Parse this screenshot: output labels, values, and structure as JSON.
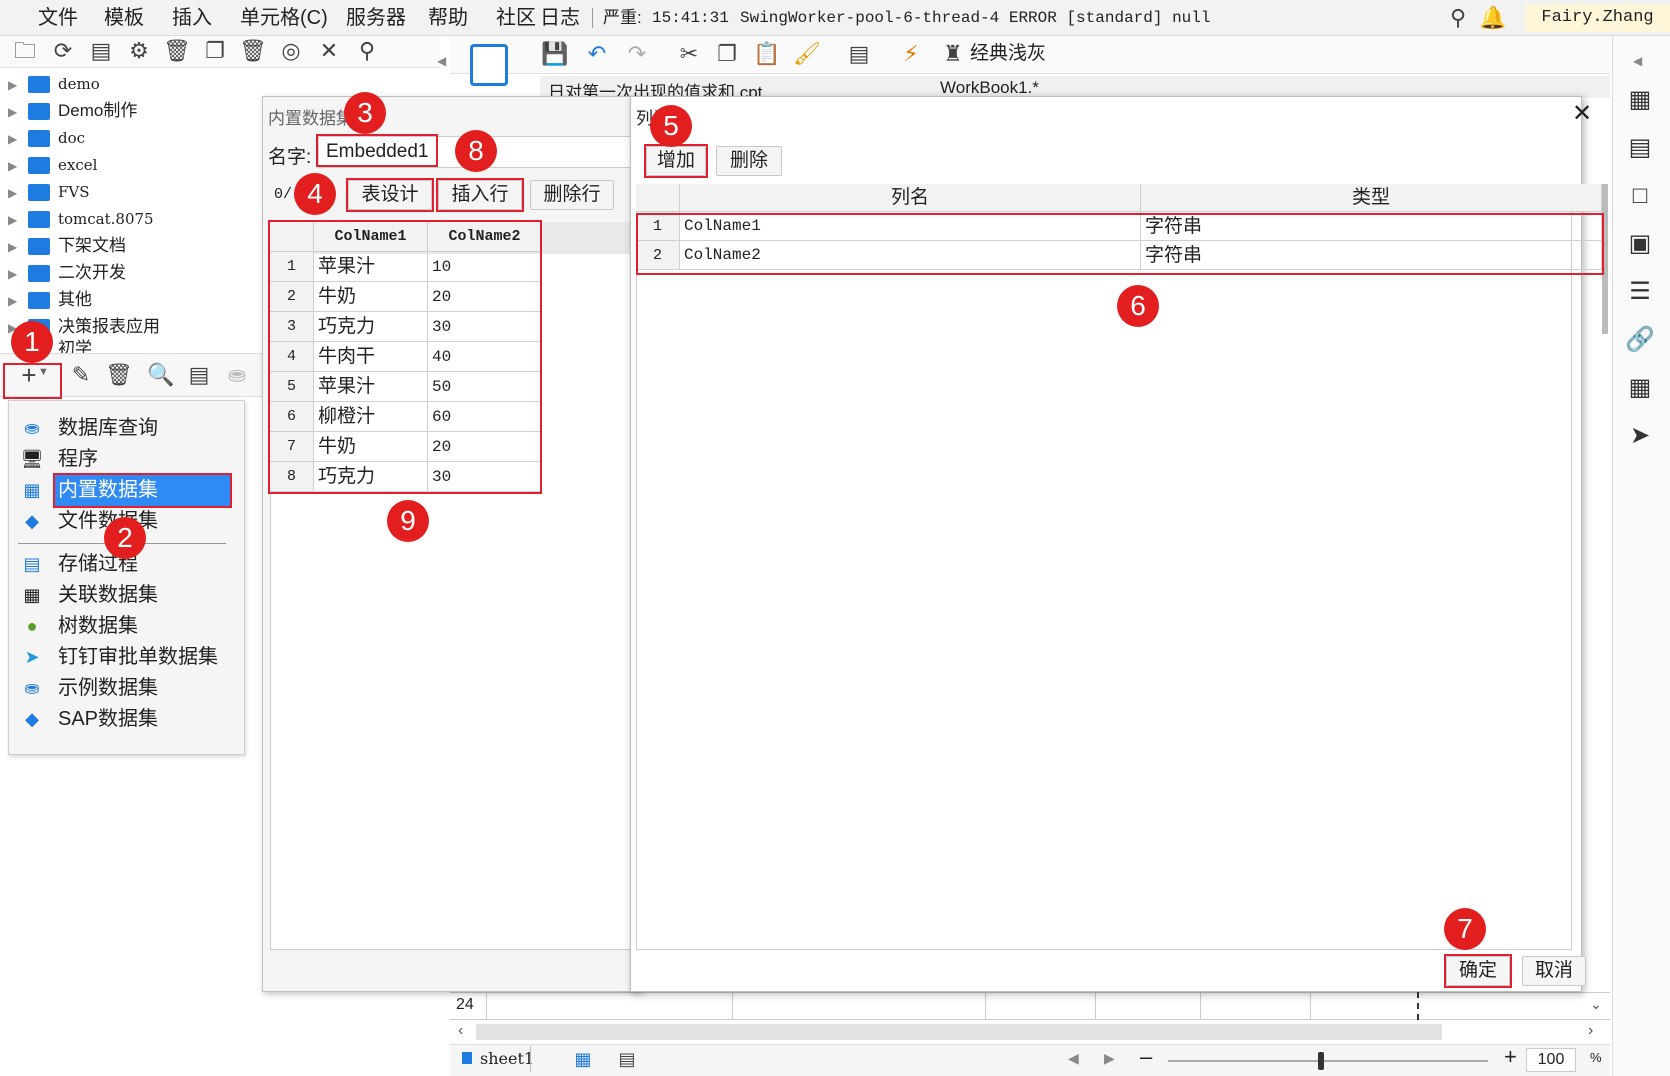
{
  "menubar": {
    "items": [
      "文件",
      "模板",
      "插入",
      "单元格(C)",
      "服务器",
      "帮助",
      "社区",
      "日志"
    ],
    "status_prefix": "严重:",
    "status_time": "15:41:31",
    "status_message": "SwingWorker-pool-6-thread-4 ERROR [standard] null",
    "user": "Fairy.Zhang"
  },
  "designer_toolbar": {
    "theme_label": "经典浅灰"
  },
  "tabs": [
    "日对第一次出现的值求和.cpt",
    "WorkBook1.*"
  ],
  "tree": {
    "items": [
      "demo",
      "Demo制作",
      "doc",
      "excel",
      "FVS",
      "tomcat.8075",
      "下架文档",
      "二次开发",
      "其他",
      "决策报表应用",
      "初学"
    ]
  },
  "dataset_menu": {
    "group1": [
      "数据库查询",
      "程序",
      "内置数据集",
      "文件数据集"
    ],
    "group2": [
      "存储过程",
      "关联数据集",
      "树数据集",
      "钉钉审批单数据集",
      "示例数据集",
      "SAP数据集"
    ],
    "selected": "内置数据集"
  },
  "embedded_dialog": {
    "title": "内置数据集",
    "name_label": "名字:",
    "name_value": "Embedded1",
    "counter": "0/",
    "btn_design": "表设计",
    "btn_insert": "插入行",
    "btn_delete": "删除行",
    "headers": [
      "ColName1",
      "ColName2"
    ],
    "rows": [
      [
        "1",
        "苹果汁",
        "10"
      ],
      [
        "2",
        "牛奶",
        "20"
      ],
      [
        "3",
        "巧克力",
        "30"
      ],
      [
        "4",
        "牛肉干",
        "40"
      ],
      [
        "5",
        "苹果汁",
        "50"
      ],
      [
        "6",
        "柳橙汁",
        "60"
      ],
      [
        "7",
        "牛奶",
        "20"
      ],
      [
        "8",
        "巧克力",
        "30"
      ]
    ]
  },
  "column_dialog": {
    "title": "列设计",
    "btn_add": "增加",
    "btn_delete": "删除",
    "headers": [
      "列名",
      "类型"
    ],
    "rows": [
      [
        "1",
        "ColName1",
        "字符串"
      ],
      [
        "2",
        "ColName2",
        "字符串"
      ]
    ],
    "btn_ok": "确定",
    "btn_cancel": "取消"
  },
  "sheet": {
    "row_number": "24",
    "tab_name": "sheet1",
    "zoom": "100",
    "zoom_unit": "%"
  },
  "badges": [
    "1",
    "2",
    "3",
    "4",
    "5",
    "6",
    "7",
    "8",
    "9"
  ],
  "colors": {
    "accent": "#1e7be0",
    "badge": "#e31e1e",
    "highlight": "#2f8af5"
  }
}
